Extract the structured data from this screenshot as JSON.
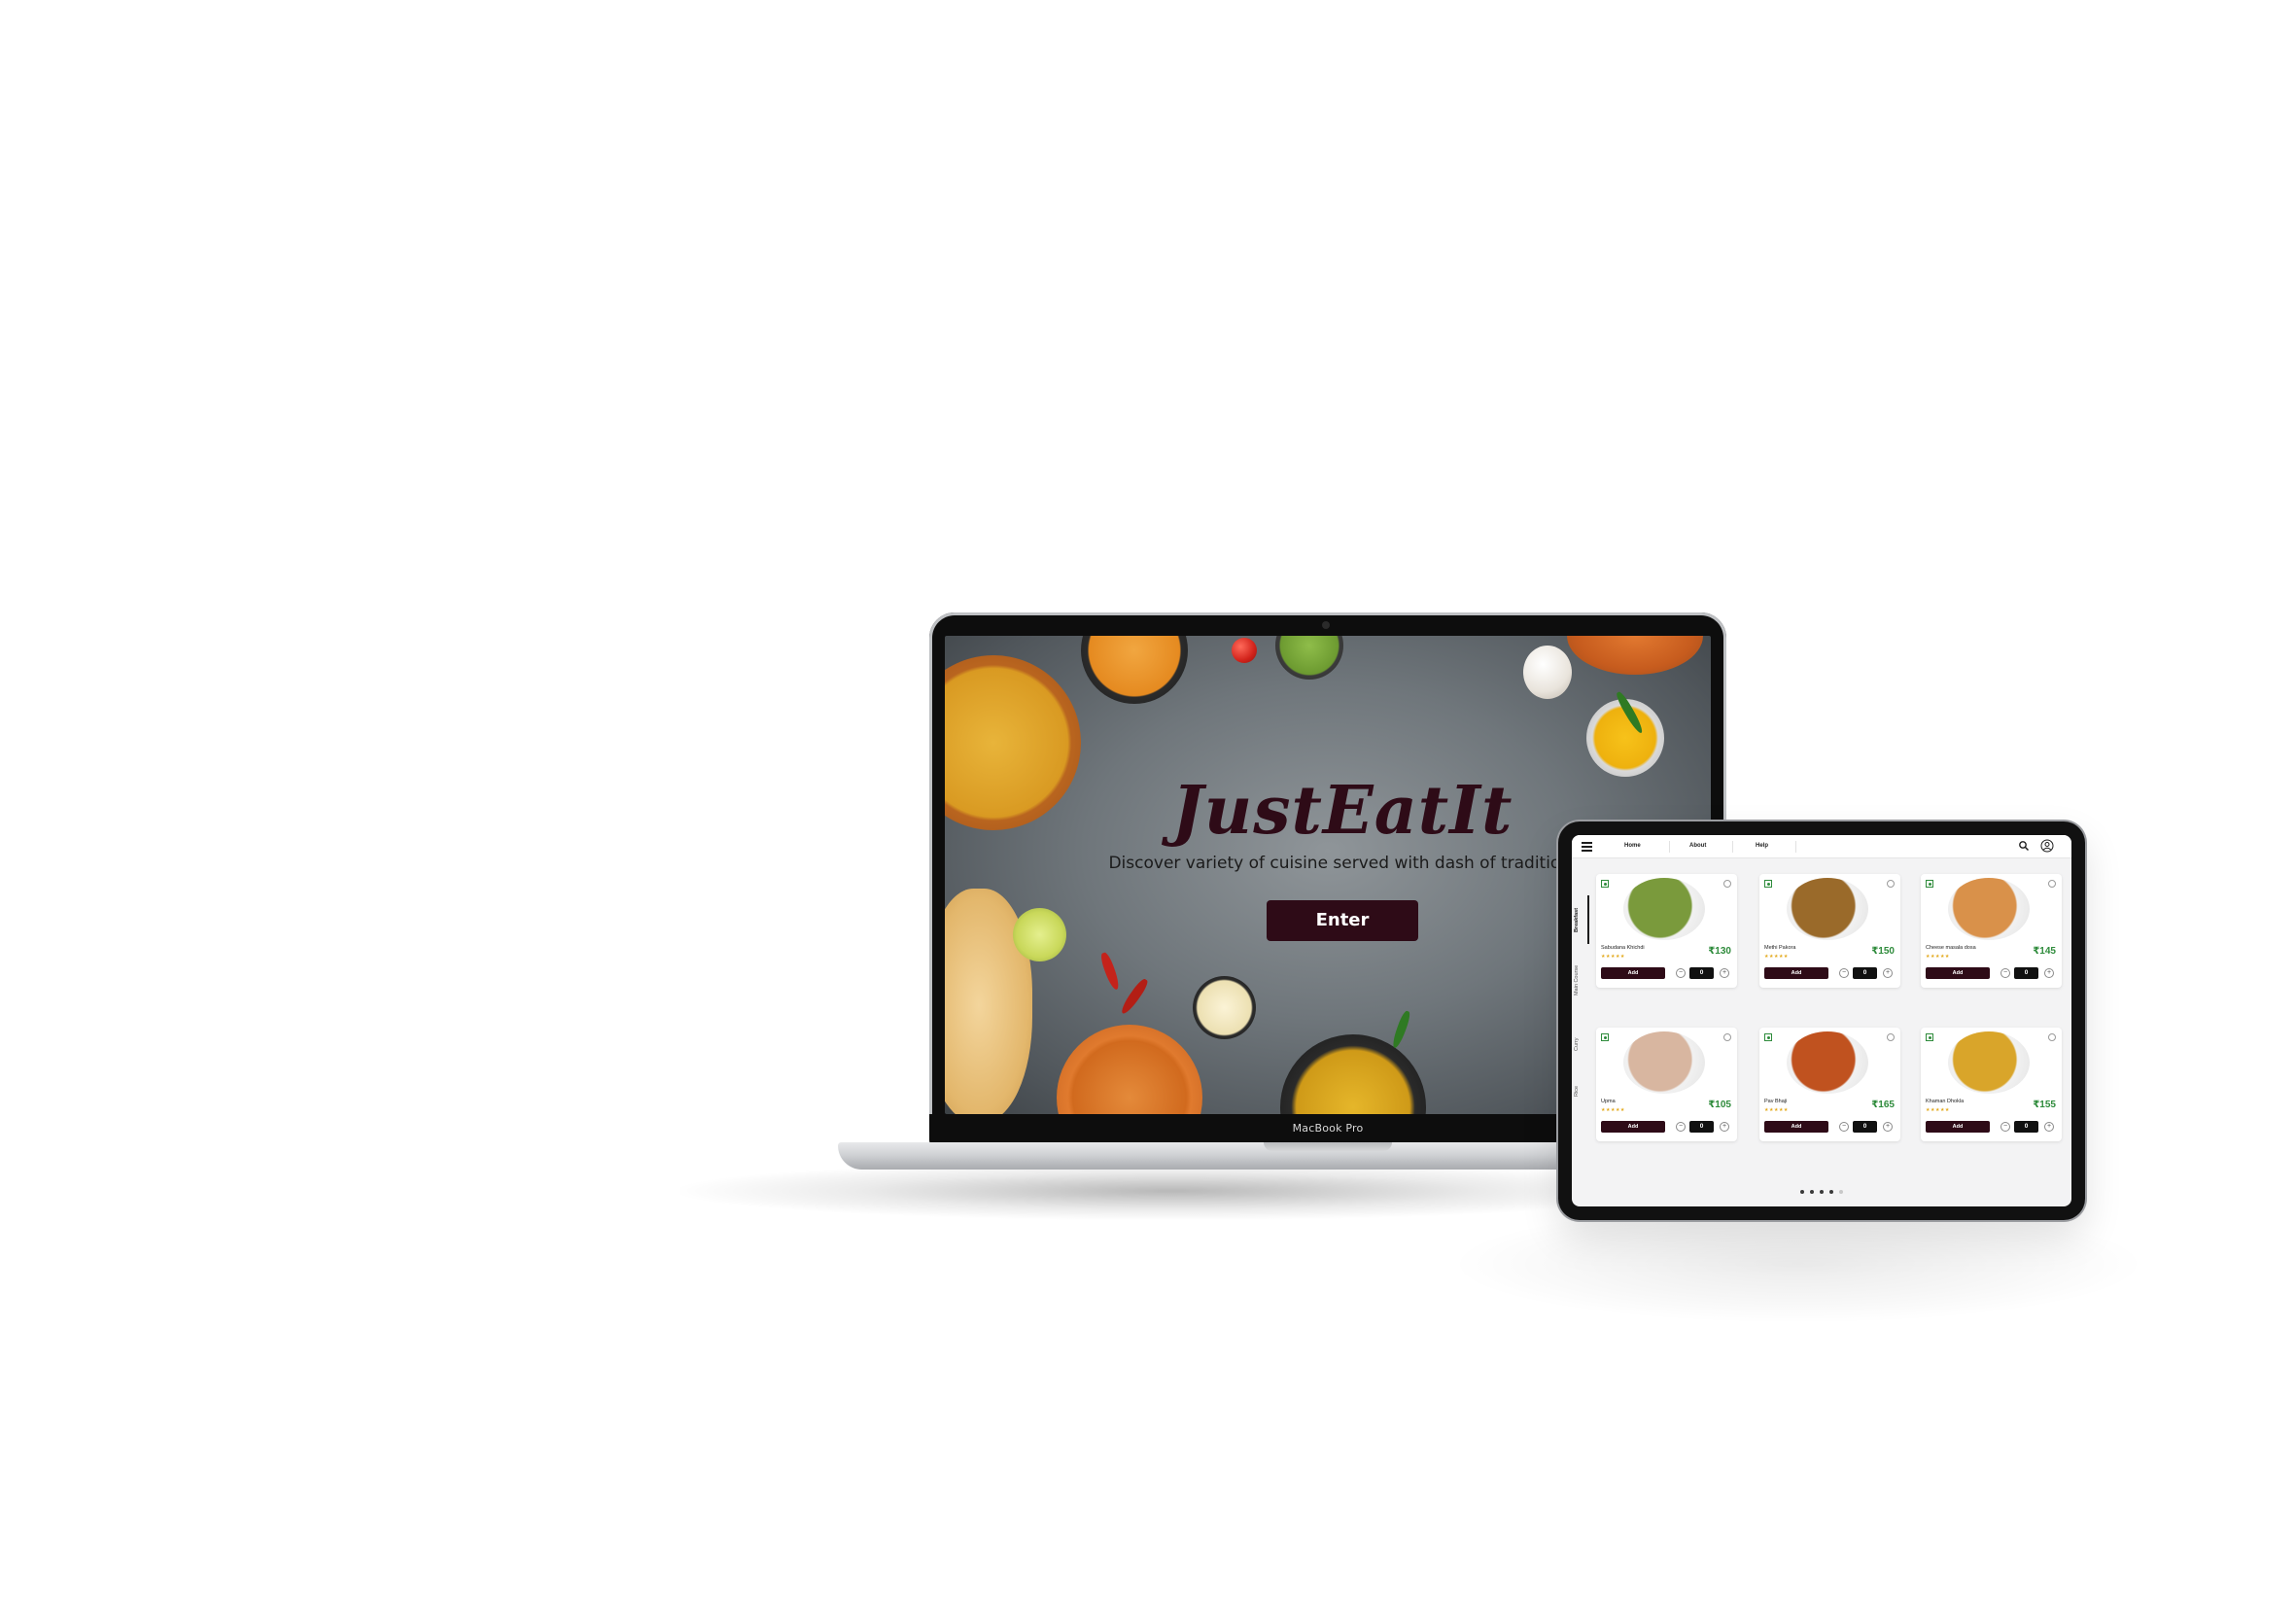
{
  "laptop": {
    "model_label": "MacBook Pro",
    "hero": {
      "title": "JustEatIt",
      "subtitle": "Discover variety of cuisine served with dash of tradition.",
      "enter_label": "Enter"
    }
  },
  "tablet": {
    "nav": {
      "menu_icon": "hamburger-menu-icon",
      "links": [
        "Home",
        "About",
        "Help"
      ],
      "search_icon": "search-icon",
      "user_icon": "user-icon"
    },
    "sidebar_tabs": [
      {
        "label": "Breakfast",
        "active": true
      },
      {
        "label": "Main Course",
        "active": false
      },
      {
        "label": "Curry",
        "active": false
      },
      {
        "label": "Rice",
        "active": false
      }
    ],
    "add_label": "Add",
    "cards": [
      {
        "name": "Sabudana Khichdi",
        "price": "₹130",
        "quantity": "0",
        "dish_color": "#7a9a3c"
      },
      {
        "name": "Methi Pakora",
        "price": "₹150",
        "quantity": "0",
        "dish_color": "#9a6a2a"
      },
      {
        "name": "Cheese masala dosa",
        "price": "₹145",
        "quantity": "0",
        "dish_color": "#d9914a"
      },
      {
        "name": "Upma",
        "price": "₹105",
        "quantity": "0",
        "dish_color": "#d8b6a0"
      },
      {
        "name": "Pav Bhaji",
        "price": "₹165",
        "quantity": "0",
        "dish_color": "#c0521f"
      },
      {
        "name": "Khaman Dhokla",
        "price": "₹155",
        "quantity": "0",
        "dish_color": "#d9a52a"
      }
    ],
    "pagination": {
      "total": 5,
      "current": 1
    },
    "colors": {
      "brand": "#2e0b17",
      "price": "#2e8b3b",
      "stars": "#e3a91c"
    }
  }
}
